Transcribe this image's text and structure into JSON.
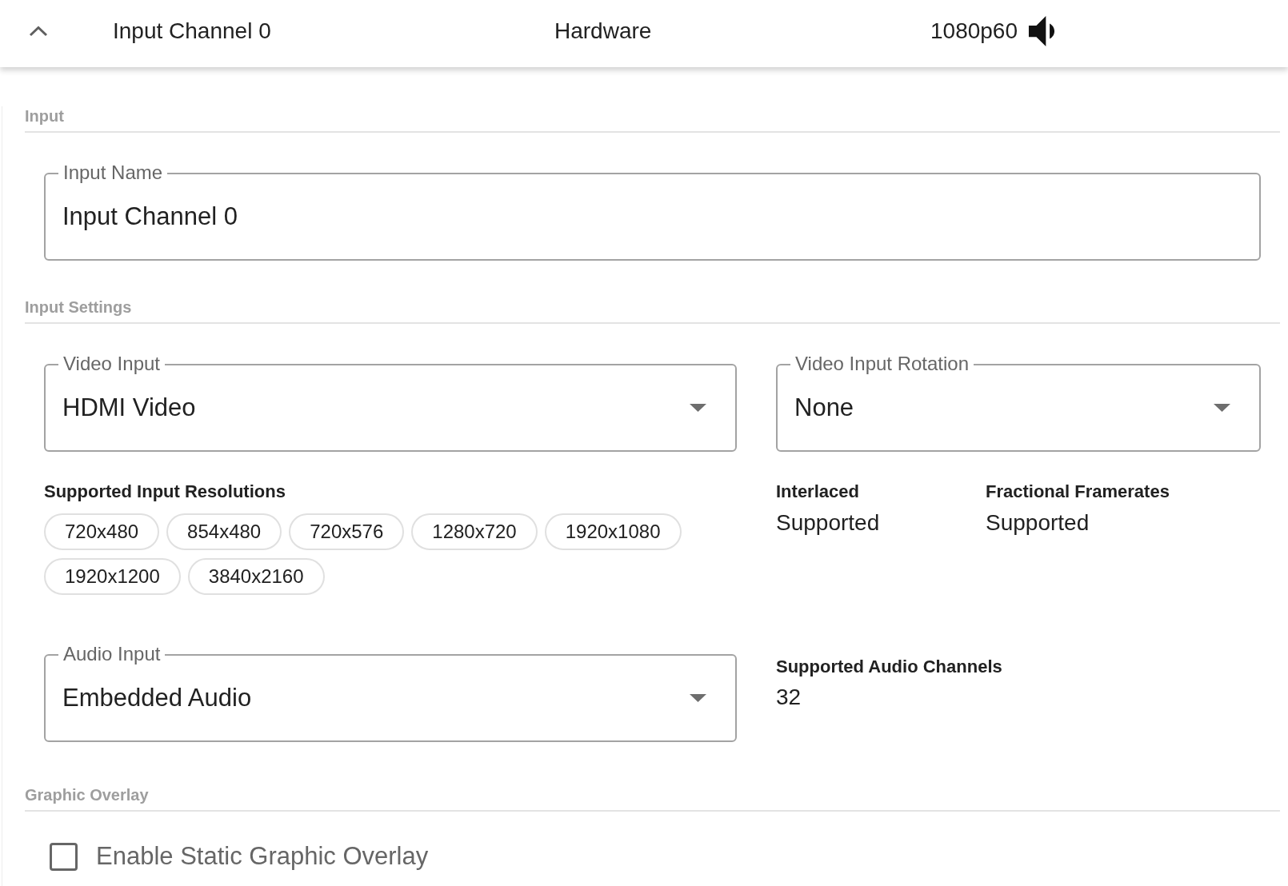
{
  "panel_header": {
    "expanded": true,
    "title": "Input Channel 0",
    "source": "Hardware",
    "video_format": "1080p60"
  },
  "input_section": {
    "heading": "Input",
    "input_name": {
      "label": "Input Name",
      "value": "Input Channel 0"
    }
  },
  "input_settings_section": {
    "heading": "Input Settings",
    "video_input": {
      "label": "Video Input",
      "value": "HDMI Video"
    },
    "video_input_rotation": {
      "label": "Video Input Rotation",
      "value": "None"
    },
    "supported_input_resolutions": {
      "label": "Supported Input Resolutions",
      "chips": [
        "720x480",
        "854x480",
        "720x576",
        "1280x720",
        "1920x1080",
        "1920x1200",
        "3840x2160"
      ]
    },
    "interlaced": {
      "label": "Interlaced",
      "value": "Supported"
    },
    "fractional_framerates": {
      "label": "Fractional Framerates",
      "value": "Supported"
    },
    "audio_input": {
      "label": "Audio Input",
      "value": "Embedded Audio"
    },
    "supported_audio_channels": {
      "label": "Supported Audio Channels",
      "value": "32"
    }
  },
  "graphic_overlay_section": {
    "heading": "Graphic Overlay",
    "enable_static_graphic_overlay": {
      "label": "Enable Static Graphic Overlay",
      "checked": false
    }
  }
}
